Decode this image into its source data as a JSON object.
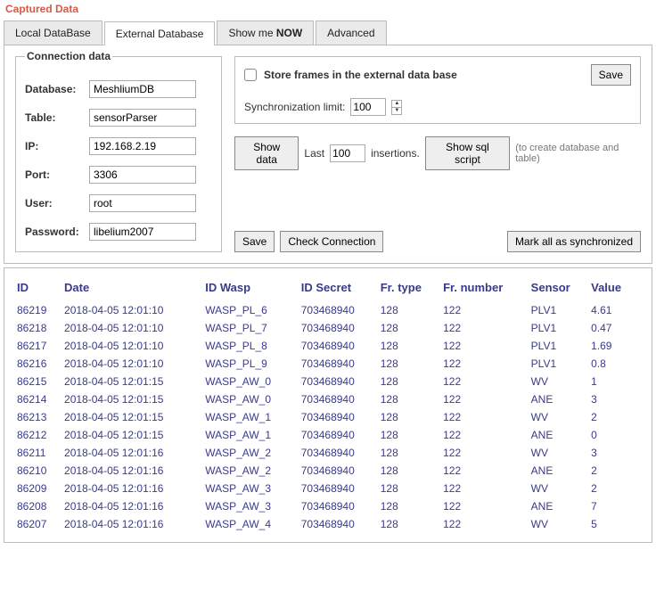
{
  "page_title": "Captured Data",
  "tabs": {
    "local": "Local DataBase",
    "external": "External Database",
    "show_now_prefix": "Show me ",
    "show_now_bold": "NOW",
    "advanced": "Advanced"
  },
  "connection": {
    "legend": "Connection data",
    "labels": {
      "database": "Database:",
      "table": "Table:",
      "ip": "IP:",
      "port": "Port:",
      "user": "User:",
      "password": "Password:"
    },
    "values": {
      "database": "MeshliumDB",
      "table": "sensorParser",
      "ip": "192.168.2.19",
      "port": "3306",
      "user": "root",
      "password": "libelium2007"
    }
  },
  "store": {
    "label": "Store frames in the external data base",
    "save": "Save",
    "sync_label": "Synchronization limit:",
    "sync_value": "100"
  },
  "toolbar": {
    "show_data": "Show data",
    "last": "Last",
    "last_value": "100",
    "insertions": "insertions.",
    "show_sql": "Show sql script",
    "hint": "(to create database and table)",
    "save": "Save",
    "check_conn": "Check Connection",
    "mark_sync": "Mark all as synchronized"
  },
  "table": {
    "headers": {
      "id": "ID",
      "date": "Date",
      "id_wasp": "ID Wasp",
      "id_secret": "ID Secret",
      "fr_type": "Fr. type",
      "fr_number": "Fr. number",
      "sensor": "Sensor",
      "value": "Value"
    },
    "rows": [
      {
        "id": "86219",
        "date": "2018-04-05 12:01:10",
        "wasp": "WASP_PL_6",
        "secret": "703468940",
        "ftype": "128",
        "fnum": "122",
        "sensor": "PLV1",
        "value": "4.61"
      },
      {
        "id": "86218",
        "date": "2018-04-05 12:01:10",
        "wasp": "WASP_PL_7",
        "secret": "703468940",
        "ftype": "128",
        "fnum": "122",
        "sensor": "PLV1",
        "value": "0.47"
      },
      {
        "id": "86217",
        "date": "2018-04-05 12:01:10",
        "wasp": "WASP_PL_8",
        "secret": "703468940",
        "ftype": "128",
        "fnum": "122",
        "sensor": "PLV1",
        "value": "1.69"
      },
      {
        "id": "86216",
        "date": "2018-04-05 12:01:10",
        "wasp": "WASP_PL_9",
        "secret": "703468940",
        "ftype": "128",
        "fnum": "122",
        "sensor": "PLV1",
        "value": "0.8"
      },
      {
        "id": "86215",
        "date": "2018-04-05 12:01:15",
        "wasp": "WASP_AW_0",
        "secret": "703468940",
        "ftype": "128",
        "fnum": "122",
        "sensor": "WV",
        "value": "1"
      },
      {
        "id": "86214",
        "date": "2018-04-05 12:01:15",
        "wasp": "WASP_AW_0",
        "secret": "703468940",
        "ftype": "128",
        "fnum": "122",
        "sensor": "ANE",
        "value": "3"
      },
      {
        "id": "86213",
        "date": "2018-04-05 12:01:15",
        "wasp": "WASP_AW_1",
        "secret": "703468940",
        "ftype": "128",
        "fnum": "122",
        "sensor": "WV",
        "value": "2"
      },
      {
        "id": "86212",
        "date": "2018-04-05 12:01:15",
        "wasp": "WASP_AW_1",
        "secret": "703468940",
        "ftype": "128",
        "fnum": "122",
        "sensor": "ANE",
        "value": "0"
      },
      {
        "id": "86211",
        "date": "2018-04-05 12:01:16",
        "wasp": "WASP_AW_2",
        "secret": "703468940",
        "ftype": "128",
        "fnum": "122",
        "sensor": "WV",
        "value": "3"
      },
      {
        "id": "86210",
        "date": "2018-04-05 12:01:16",
        "wasp": "WASP_AW_2",
        "secret": "703468940",
        "ftype": "128",
        "fnum": "122",
        "sensor": "ANE",
        "value": "2"
      },
      {
        "id": "86209",
        "date": "2018-04-05 12:01:16",
        "wasp": "WASP_AW_3",
        "secret": "703468940",
        "ftype": "128",
        "fnum": "122",
        "sensor": "WV",
        "value": "2"
      },
      {
        "id": "86208",
        "date": "2018-04-05 12:01:16",
        "wasp": "WASP_AW_3",
        "secret": "703468940",
        "ftype": "128",
        "fnum": "122",
        "sensor": "ANE",
        "value": "7"
      },
      {
        "id": "86207",
        "date": "2018-04-05 12:01:16",
        "wasp": "WASP_AW_4",
        "secret": "703468940",
        "ftype": "128",
        "fnum": "122",
        "sensor": "WV",
        "value": "5"
      }
    ]
  }
}
